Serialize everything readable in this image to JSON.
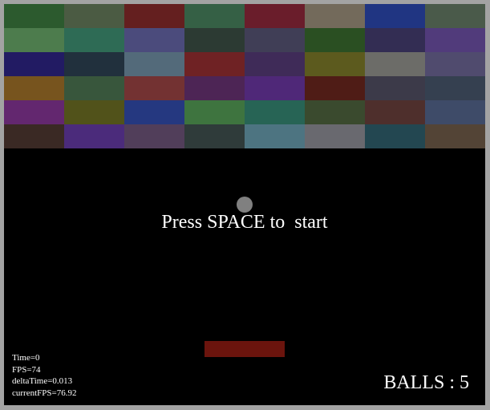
{
  "game": {
    "start_message": "Press SPACE to  start",
    "balls_label": "BALLS : 5",
    "paddle_color": "#6b140d",
    "ball_color": "#808080",
    "background_color": "#000000"
  },
  "debug": {
    "time": "Time=0",
    "fps": "FPS=74",
    "delta_time": "deltaTime=0.013",
    "current_fps": "currentFPS=76.92"
  },
  "bricks": [
    [
      "#2c5a2e",
      "#4b5b43",
      "#641f1f",
      "#356045",
      "#6a1d2b",
      "#736a5b",
      "#203582",
      "#4a5a4a"
    ],
    [
      "#4d7c4d",
      "#2e6b55",
      "#4b4b7c",
      "#2c3a33",
      "#403e56",
      "#2a4f22",
      "#332d53",
      "#513b7b"
    ],
    [
      "#221b63",
      "#21303d",
      "#536a7a",
      "#6f2224",
      "#3f2b58",
      "#5c5a1e",
      "#6c6c68",
      "#504b6e"
    ],
    [
      "#77541e",
      "#38563c",
      "#733232",
      "#4d2555",
      "#4f2878",
      "#4f1c16",
      "#3c3a49",
      "#354050"
    ],
    [
      "#63276f",
      "#51521a",
      "#253880",
      "#3e743f",
      "#276455",
      "#3a4a2e",
      "#4e2f2c",
      "#3e4b68"
    ],
    [
      "#3a2924",
      "#4b2b7b",
      "#513e5a",
      "#2f3b3a",
      "#4d7481",
      "#69696f",
      "#234751",
      "#534436"
    ]
  ]
}
